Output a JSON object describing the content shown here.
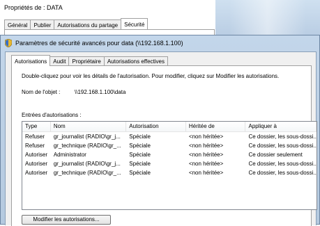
{
  "background_window": {
    "title": "Propriétés de : DATA",
    "tabs": [
      "Général",
      "Publier",
      "Autorisations du partage",
      "Sécurité"
    ]
  },
  "window": {
    "title": "Paramètres de sécurité avancés pour data (\\\\192.168.1.100)"
  },
  "tabs": [
    "Autorisations",
    "Audit",
    "Propriétaire",
    "Autorisations effectives"
  ],
  "panel": {
    "instructions": "Double-cliquez pour voir les détails de l'autorisation. Pour modifier, cliquez sur Modifier les autorisations.",
    "object_label": "Nom de l'objet :",
    "object_value": "\\\\192.168.1.100\\data",
    "entries_label": "Entrées d'autorisations :"
  },
  "table": {
    "columns": [
      "Type",
      "Nom",
      "Autorisation",
      "Héritée de",
      "Appliquer à"
    ],
    "rows": [
      [
        "Refuser",
        "gr_journalist (RADIO\\gr_j...",
        "Spéciale",
        "<non héritée>",
        "Ce dossier, les sous-dossi..."
      ],
      [
        "Refuser",
        "gr_technique (RADIO\\gr_...",
        "Spéciale",
        "<non héritée>",
        "Ce dossier, les sous-dossi..."
      ],
      [
        "Autoriser",
        "Administrator",
        "Spéciale",
        "<non héritée>",
        "Ce dossier seulement"
      ],
      [
        "Autoriser",
        "gr_journalist (RADIO\\gr_j...",
        "Spéciale",
        "<non héritée>",
        "Ce dossier, les sous-dossi..."
      ],
      [
        "Autoriser",
        "gr_technique (RADIO\\gr_...",
        "Spéciale",
        "<non héritée>",
        "Ce dossier, les sous-dossi..."
      ]
    ]
  },
  "buttons": {
    "modify": "Modifier les autorisations..."
  },
  "icons": {
    "window": "shield-icon"
  }
}
